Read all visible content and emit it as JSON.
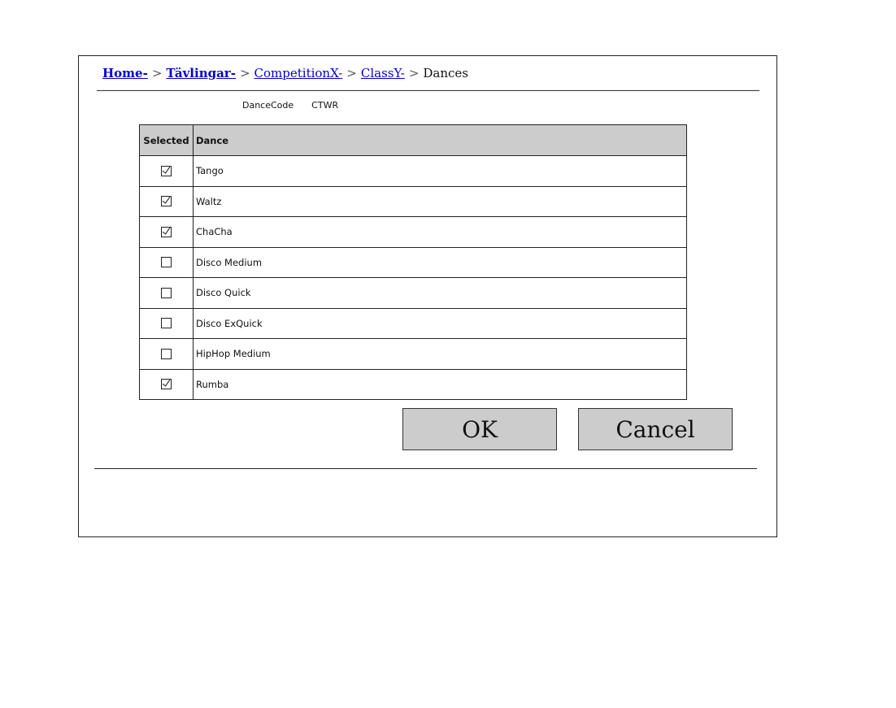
{
  "breadcrumb": {
    "home": "Home-",
    "tavlingar": "Tävlingar-",
    "competition": "CompetitionX-",
    "class": "ClassY-",
    "current": "Dances",
    "separator": ">"
  },
  "dance_code": {
    "label": "DanceCode",
    "value": "CTWR"
  },
  "table": {
    "headers": {
      "selected": "Selected",
      "dance": "Dance"
    },
    "rows": [
      {
        "dance": "Tango",
        "selected": true
      },
      {
        "dance": "Waltz",
        "selected": true
      },
      {
        "dance": "ChaCha",
        "selected": true
      },
      {
        "dance": "Disco Medium",
        "selected": false
      },
      {
        "dance": "Disco Quick",
        "selected": false
      },
      {
        "dance": "Disco ExQuick",
        "selected": false
      },
      {
        "dance": "HipHop Medium",
        "selected": false
      },
      {
        "dance": "Rumba",
        "selected": true
      }
    ]
  },
  "buttons": {
    "ok": "OK",
    "cancel": "Cancel"
  }
}
